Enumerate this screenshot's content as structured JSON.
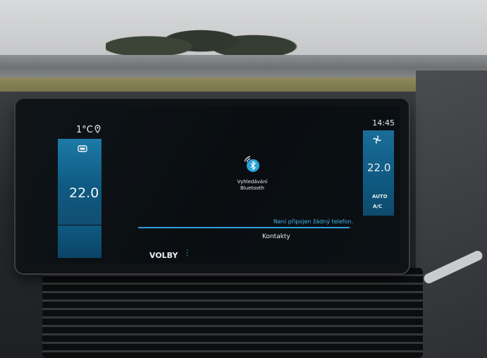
{
  "status_bar": {
    "outside_temp": "1°C",
    "location_icon": "location-pin-icon",
    "clock": "14:45"
  },
  "climate": {
    "left": {
      "icon": "seat-heat-icon",
      "temperature": "22.0"
    },
    "right": {
      "icon": "fan-icon",
      "temperature": "22.0",
      "auto_label": "AUTO",
      "ac_label": "A/C"
    }
  },
  "bluetooth": {
    "icon": "bluetooth-search-icon",
    "title_line1": "Vyhledávání",
    "title_line2": "Bluetooth",
    "status": "Není připojen žádný telefon."
  },
  "footer": {
    "contacts_label": "Kontakty",
    "options_label": "VOLBY",
    "more_icon": "more-vertical-icon"
  },
  "colors": {
    "accent": "#2aa3d8",
    "panel": "#0f5a82"
  }
}
